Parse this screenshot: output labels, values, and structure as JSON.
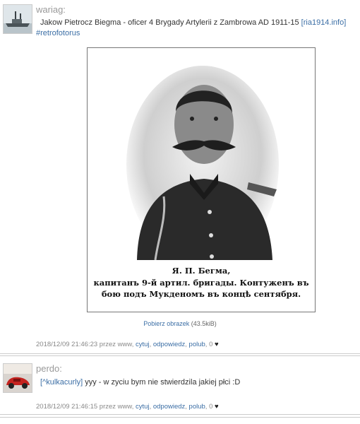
{
  "posts": [
    {
      "author": "wariag:",
      "text_main": "Jakow Pietrocz Biegma - oficer 4 Brygady Artylerii z Zambrowa AD 1911-15 ",
      "source_link": "[ria1914.info]",
      "tag": "#retrofotorus",
      "image_link": "Pobierz obrazek",
      "image_size": "(43.5kiB)",
      "caption_lines": [
        "Я. П. Бегма,",
        "капитанъ 9-й артил. бригады. Контуженъ въ",
        "бою подъ Мукденомъ въ концѣ сентября."
      ],
      "meta_time": "2018/12/09 21:46:23 przez www,",
      "actions": [
        "cytuj",
        "odpowiedz",
        "polub"
      ],
      "likes": "0",
      "heart": "♥"
    },
    {
      "author": "perdo:",
      "reply_link": "[^kulkacurly]",
      "text_main": " yyy - w zyciu bym nie stwierdzila jakiej płci :D",
      "meta_time": "2018/12/09 21:46:15 przez www,",
      "actions": [
        "cytuj",
        "odpowiedz",
        "polub"
      ],
      "likes": "0",
      "heart": "♥"
    }
  ]
}
